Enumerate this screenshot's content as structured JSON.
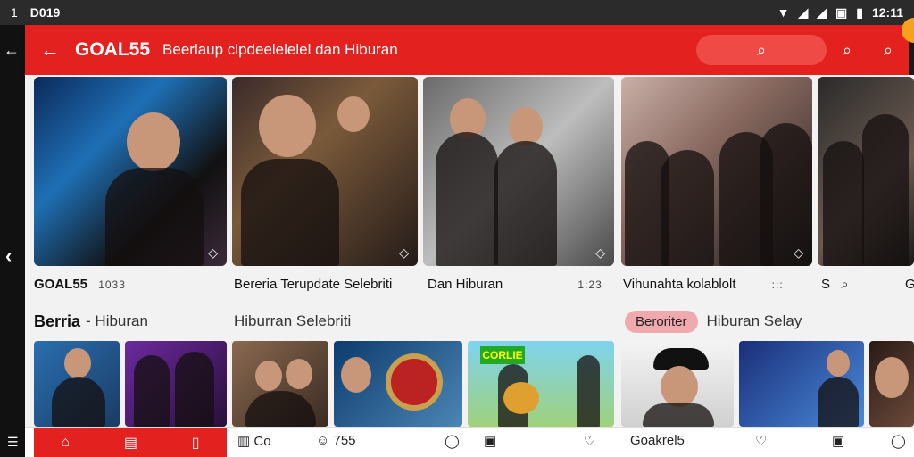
{
  "status_bar": {
    "left_number": "1",
    "time_left": "D019",
    "time_right": "12:11"
  },
  "app_bar": {
    "brand": "GOAL55",
    "tagline": "Beerlaup clpdeelelelel dan Hiburan",
    "accent_color": "#e3211f"
  },
  "captions": [
    {
      "title": "GOAL55",
      "meta": "1033"
    },
    {
      "title": "Bereria Terupdate Selebriti",
      "meta": ""
    },
    {
      "title": "Dan Hiburan",
      "meta": "1:23"
    },
    {
      "title": "Vihunahta kolablolt",
      "meta": ":::"
    },
    {
      "title": "S",
      "meta": ""
    },
    {
      "title": "G",
      "meta": ""
    }
  ],
  "sections": {
    "left_bold": "Berria",
    "left_rest": "- Hiburan",
    "middle": "Hiburran Selebriti",
    "chip": "Beroriter",
    "right": "Hiburan Selay"
  },
  "thumbs": {
    "sign_text": "CORLIE"
  },
  "bottom_nav": {
    "item1": "Co",
    "item2": "755",
    "item3": "Goakrel5"
  }
}
